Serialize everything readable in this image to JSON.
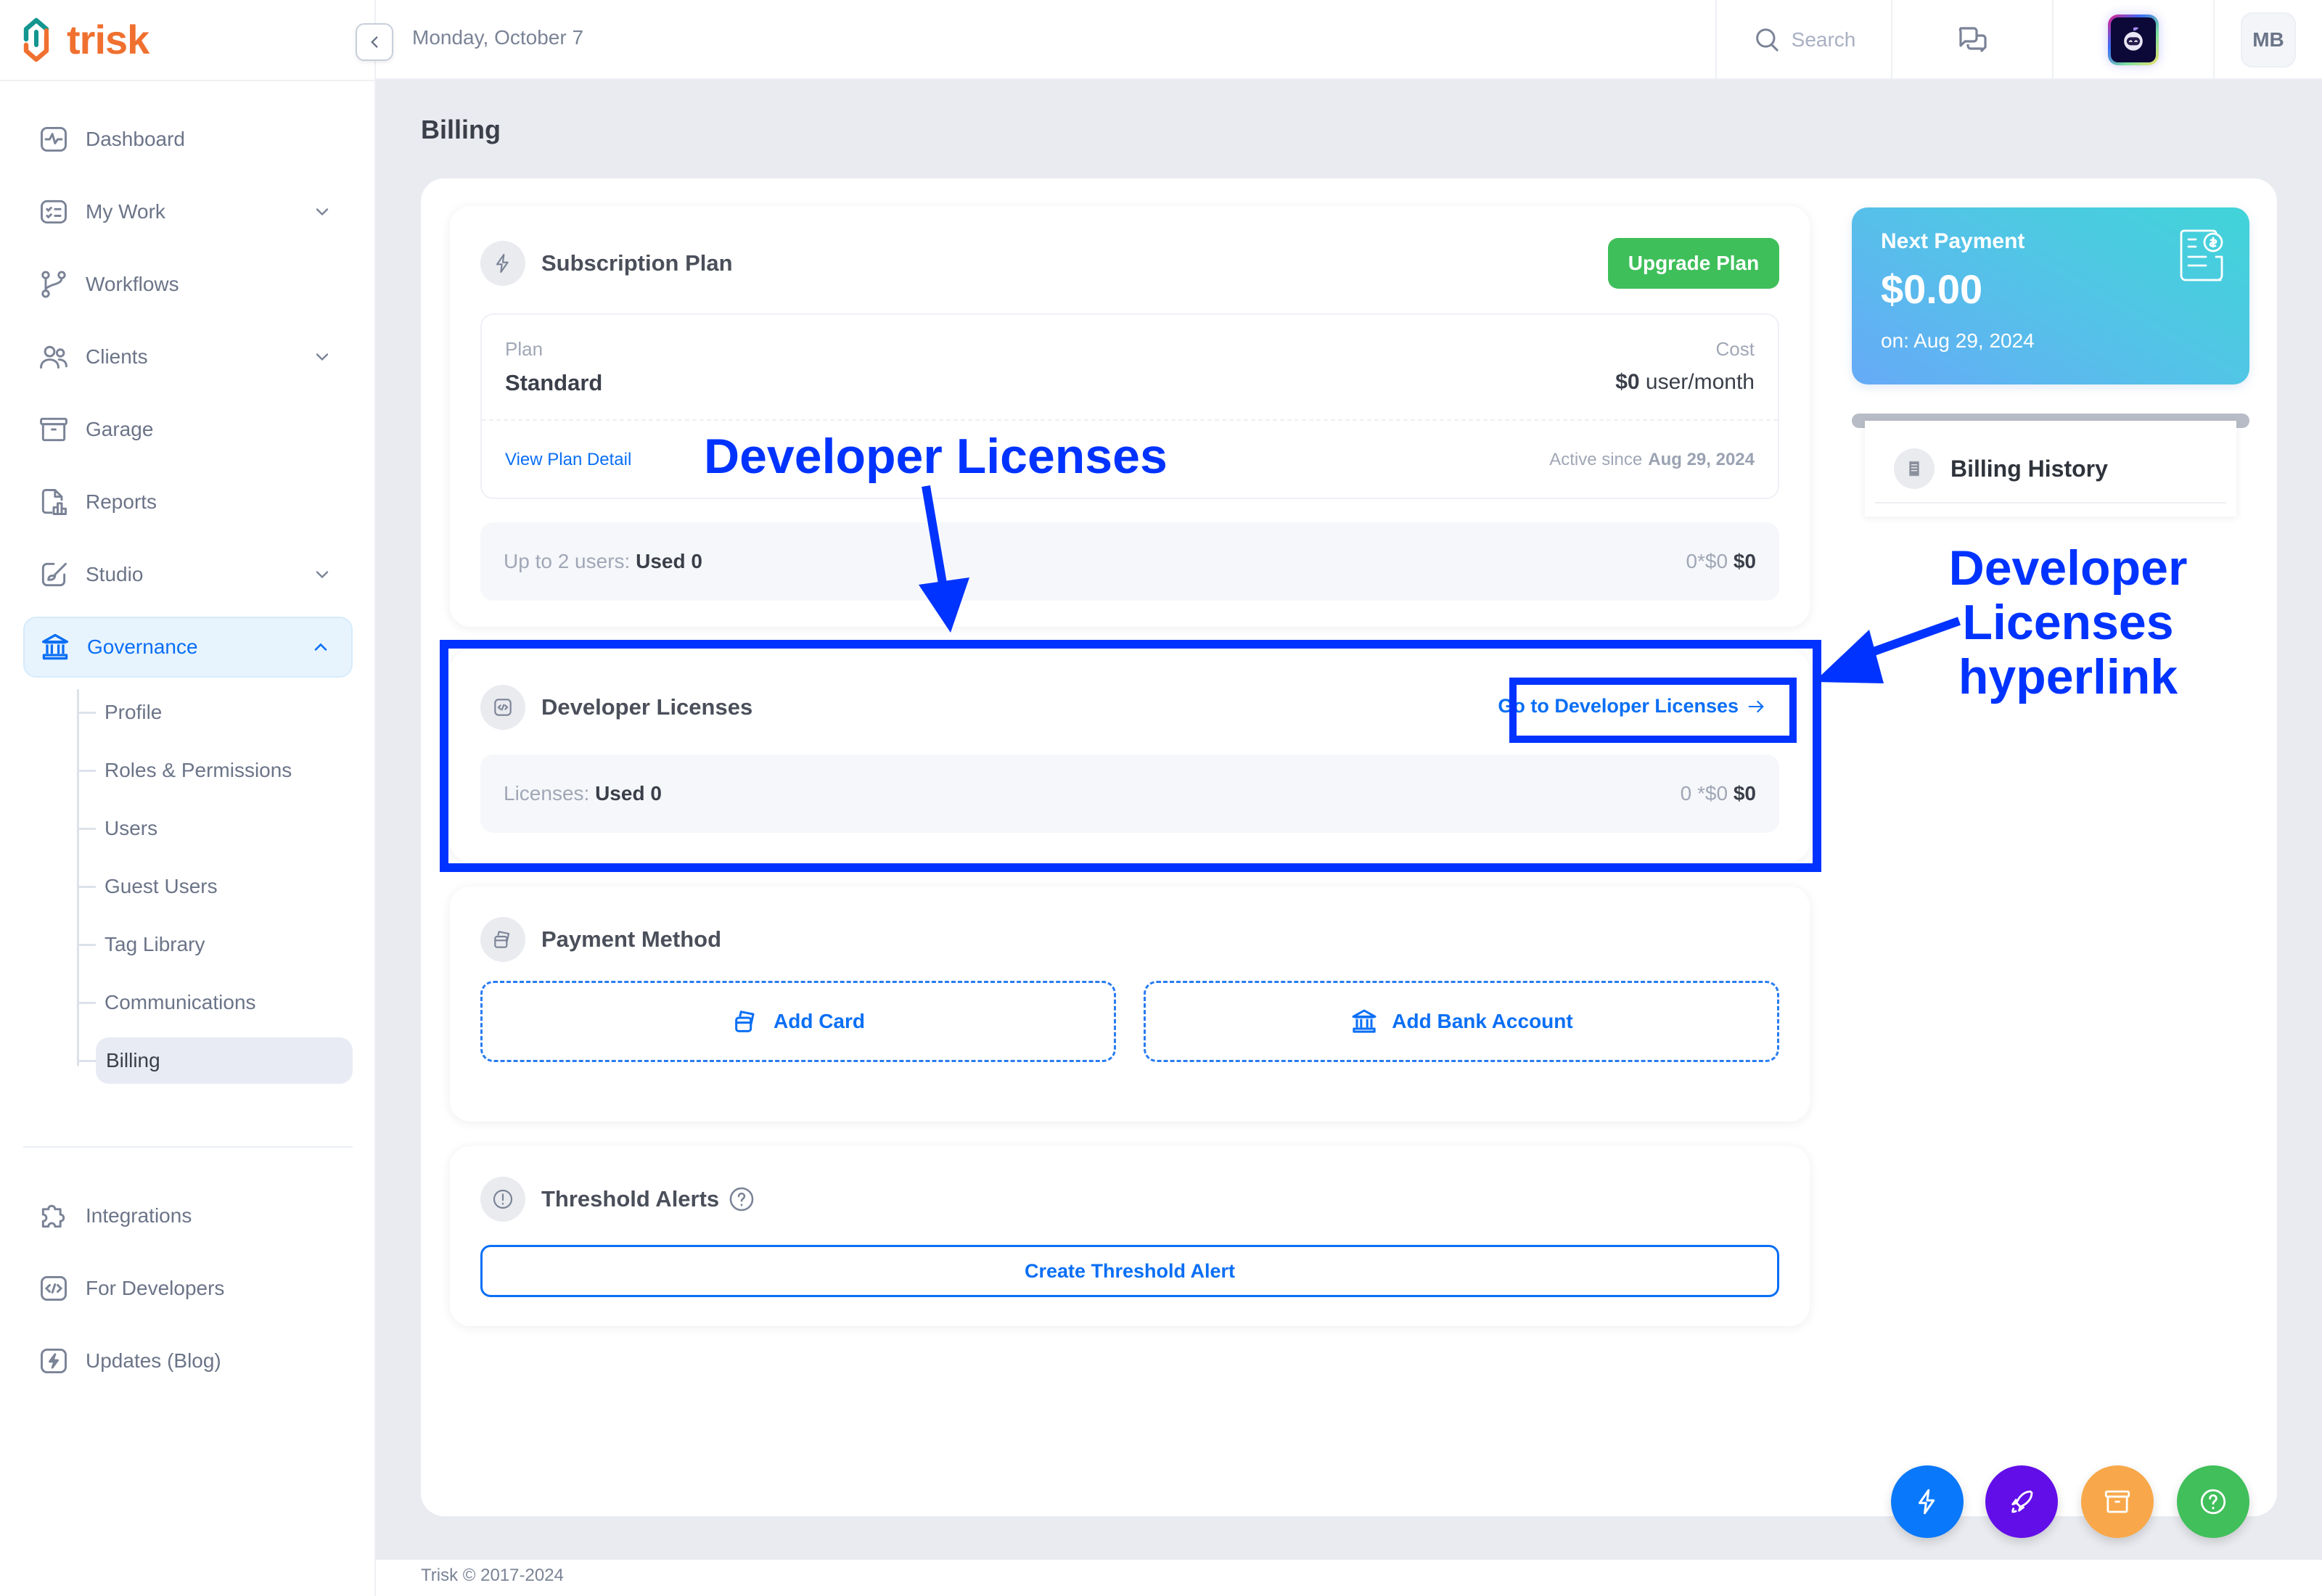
{
  "app": {
    "name": "trisk",
    "date": "Monday, October 7"
  },
  "topbar": {
    "search_placeholder": "Search",
    "user_initials": "MB"
  },
  "sidebar": {
    "items": [
      {
        "label": "Dashboard",
        "icon": "dashboard-icon",
        "has_chevron": false
      },
      {
        "label": "My Work",
        "icon": "checklist-icon",
        "has_chevron": true
      },
      {
        "label": "Workflows",
        "icon": "git-branch-icon",
        "has_chevron": false
      },
      {
        "label": "Clients",
        "icon": "users-icon",
        "has_chevron": true
      },
      {
        "label": "Garage",
        "icon": "archive-icon",
        "has_chevron": false
      },
      {
        "label": "Reports",
        "icon": "report-icon",
        "has_chevron": false
      },
      {
        "label": "Studio",
        "icon": "brush-icon",
        "has_chevron": true
      },
      {
        "label": "Governance",
        "icon": "bank-icon",
        "has_chevron": true,
        "active": true
      }
    ],
    "governance_sub": [
      "Profile",
      "Roles & Permissions",
      "Users",
      "Guest Users",
      "Tag Library",
      "Communications",
      "Billing"
    ],
    "active_sub": "Billing",
    "bottom_items": [
      {
        "label": "Integrations",
        "icon": "puzzle-icon"
      },
      {
        "label": "For Developers",
        "icon": "code-icon"
      },
      {
        "label": "Updates (Blog)",
        "icon": "lightning-icon"
      }
    ]
  },
  "page": {
    "title": "Billing"
  },
  "subscription": {
    "title": "Subscription Plan",
    "upgrade_label": "Upgrade Plan",
    "plan_label": "Plan",
    "plan_value": "Standard",
    "cost_label": "Cost",
    "cost_amount": "$0",
    "cost_unit": "user/month",
    "view_detail": "View Plan Detail",
    "active_since_label": "Active since",
    "active_since_date": "Aug 29, 2024",
    "usage_label": "Up to 2 users:",
    "usage_value": "Used 0",
    "usage_formula": "0*$0",
    "usage_total": "$0"
  },
  "developer_licenses": {
    "title": "Developer Licenses",
    "link_label": "Go to Developer Licenses",
    "usage_label": "Licenses:",
    "usage_value": "Used 0",
    "usage_formula": "0 *$0",
    "usage_total": "$0"
  },
  "payment_method": {
    "title": "Payment Method",
    "add_card": "Add Card",
    "add_bank": "Add Bank Account"
  },
  "threshold_alerts": {
    "title": "Threshold Alerts",
    "create_label": "Create Threshold Alert"
  },
  "next_payment": {
    "title": "Next Payment",
    "amount": "$0.00",
    "date": "on: Aug 29, 2024"
  },
  "billing_history": {
    "title": "Billing History"
  },
  "fabs": [
    {
      "name": "quick-actions",
      "color": "#0a78fa"
    },
    {
      "name": "launch",
      "color": "#620ee8"
    },
    {
      "name": "archive",
      "color": "#f8a84a"
    },
    {
      "name": "help",
      "color": "#40bf5a"
    }
  ],
  "footer": {
    "copyright": "Trisk © 2017-2024"
  },
  "annotations": {
    "color": "#0033ff",
    "section_label": "Developer Licenses",
    "link_label_lines": [
      "Developer",
      "Licenses",
      "hyperlink"
    ]
  },
  "colors": {
    "accent": "#0a6ff5",
    "upgrade": "#3fbf5a",
    "logo": "#f07030",
    "logo_teal": "#12968f"
  }
}
